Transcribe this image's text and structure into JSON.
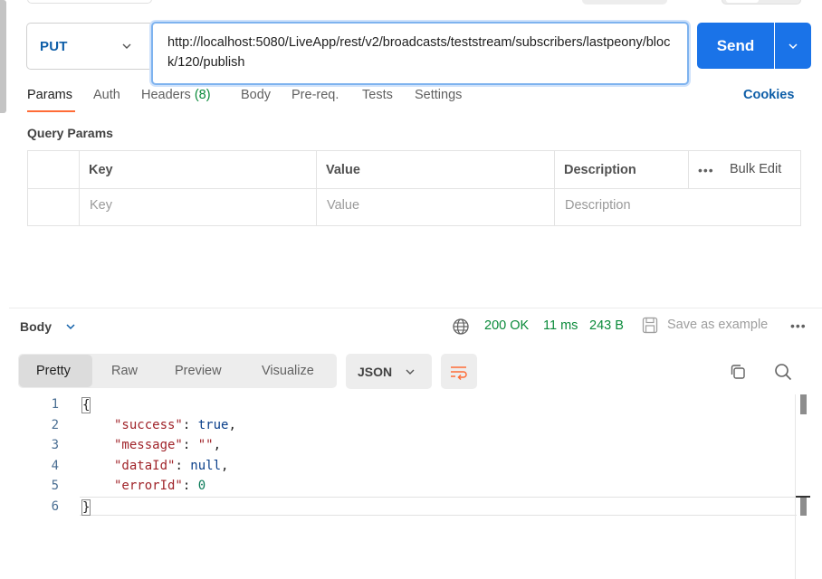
{
  "request": {
    "method": "PUT",
    "url": "http://localhost:5080/LiveApp/rest/v2/broadcasts/teststream/subscribers/lastpeony/block/120/publish",
    "send_label": "Send"
  },
  "request_tabs": [
    {
      "label": "Params"
    },
    {
      "label": "Auth"
    },
    {
      "label": "Headers",
      "count": "(8)"
    },
    {
      "label": "Body"
    },
    {
      "label": "Pre-req."
    },
    {
      "label": "Tests"
    },
    {
      "label": "Settings"
    }
  ],
  "cookies_label": "Cookies",
  "query_params": {
    "title": "Query Params",
    "columns": [
      "Key",
      "Value",
      "Description"
    ],
    "bulk_edit": "Bulk Edit",
    "placeholders": [
      "Key",
      "Value",
      "Description"
    ]
  },
  "response": {
    "section_label": "Body",
    "status": "200 OK",
    "time": "11 ms",
    "size": "243 B",
    "save_label": "Save as example",
    "view_tabs": [
      "Pretty",
      "Raw",
      "Preview",
      "Visualize"
    ],
    "format": "JSON",
    "line_numbers": [
      "1",
      "2",
      "3",
      "4",
      "5",
      "6"
    ],
    "json": {
      "open": "{",
      "close": "}",
      "fields": [
        {
          "key": "\"success\"",
          "value": "true",
          "type": "bool",
          "comma": ","
        },
        {
          "key": "\"message\"",
          "value": "\"\"",
          "type": "string",
          "comma": ","
        },
        {
          "key": "\"dataId\"",
          "value": "null",
          "type": "bool",
          "comma": ","
        },
        {
          "key": "\"errorId\"",
          "value": "0",
          "type": "number",
          "comma": ""
        }
      ]
    }
  },
  "colors": {
    "accent": "#1a73e8",
    "tab_underline": "#ff6c37",
    "success": "#0a8a3a",
    "method": "#0e5ea8"
  }
}
